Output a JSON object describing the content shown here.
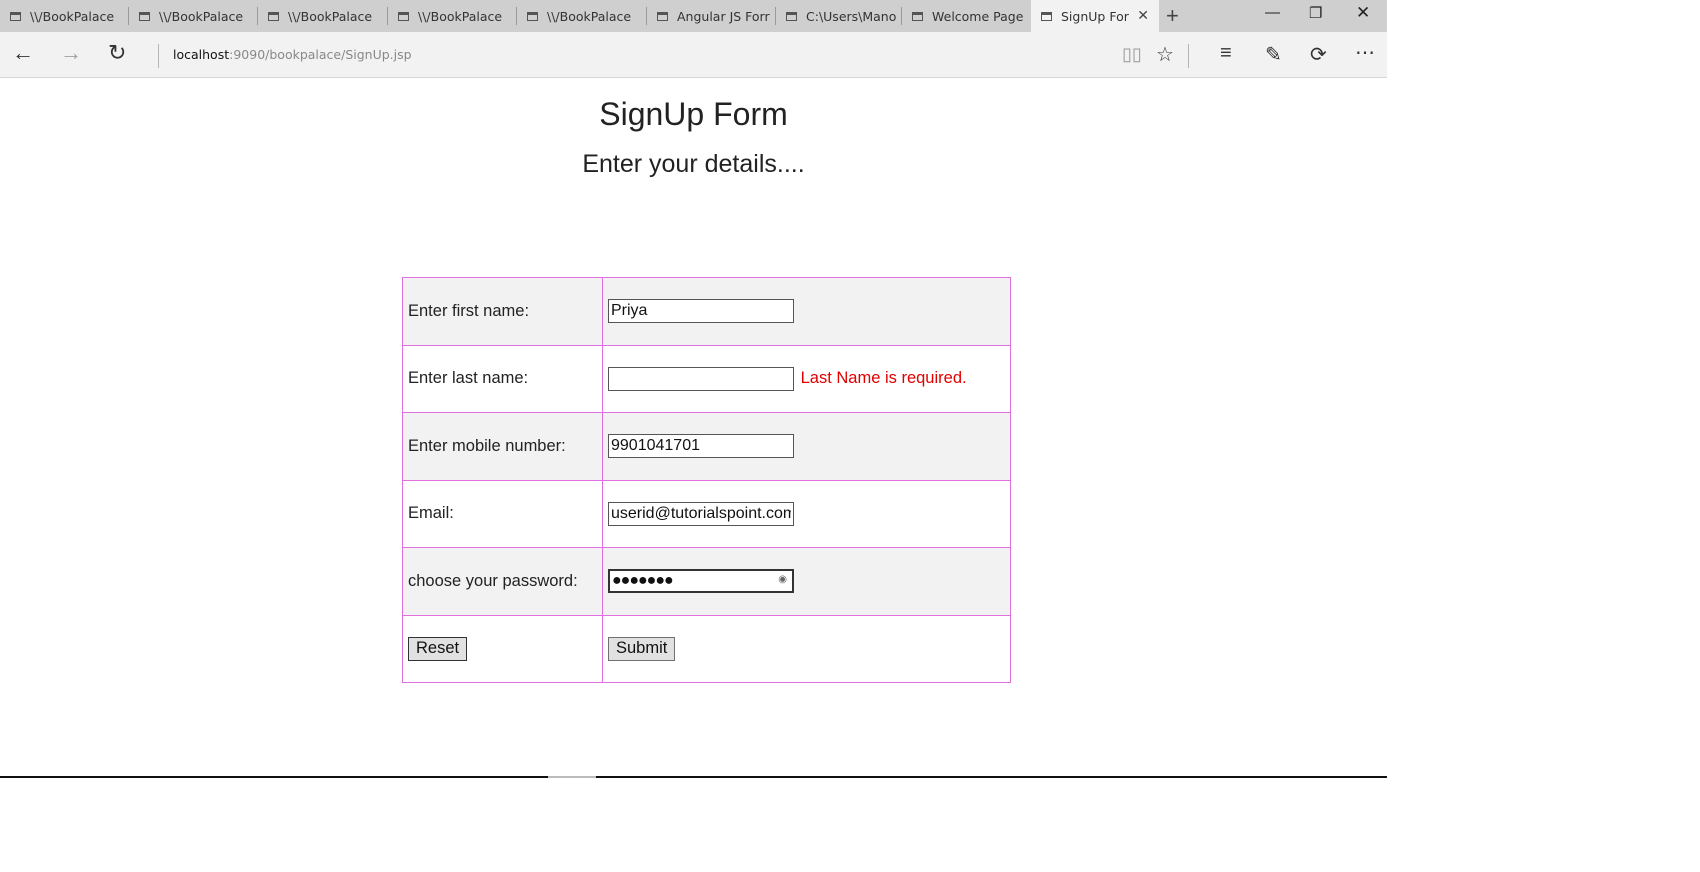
{
  "browser": {
    "tabs": [
      {
        "title": "\\\\/BookPalace"
      },
      {
        "title": "\\\\/BookPalace"
      },
      {
        "title": "\\\\/BookPalace"
      },
      {
        "title": "\\\\/BookPalace"
      },
      {
        "title": "\\\\/BookPalace"
      },
      {
        "title": "Angular JS Forr"
      },
      {
        "title": "C:\\Users\\Mano"
      },
      {
        "title": "Welcome Page"
      },
      {
        "title": "SignUp For"
      }
    ],
    "address": {
      "host": "localhost",
      "path": ":9090/bookpalace/SignUp.jsp"
    }
  },
  "page": {
    "title": "SignUp Form",
    "subtitle": "Enter your details...."
  },
  "form": {
    "first_name_label": "Enter first name:",
    "first_name_value": "Priya",
    "last_name_label": "Enter last name:",
    "last_name_value": "",
    "last_name_error": "Last Name is required.",
    "mobile_label": "Enter mobile number:",
    "mobile_value": "9901041701",
    "email_label": "Email:",
    "email_value": "userid@tutorialspoint.com",
    "password_label": "choose your password:",
    "password_value": "●●●●●●●",
    "reset_label": "Reset",
    "submit_label": "Submit"
  },
  "colors": {
    "table_border": "#e070e0",
    "error_text": "#e00000",
    "shaded_row": "#f2f2f2"
  }
}
